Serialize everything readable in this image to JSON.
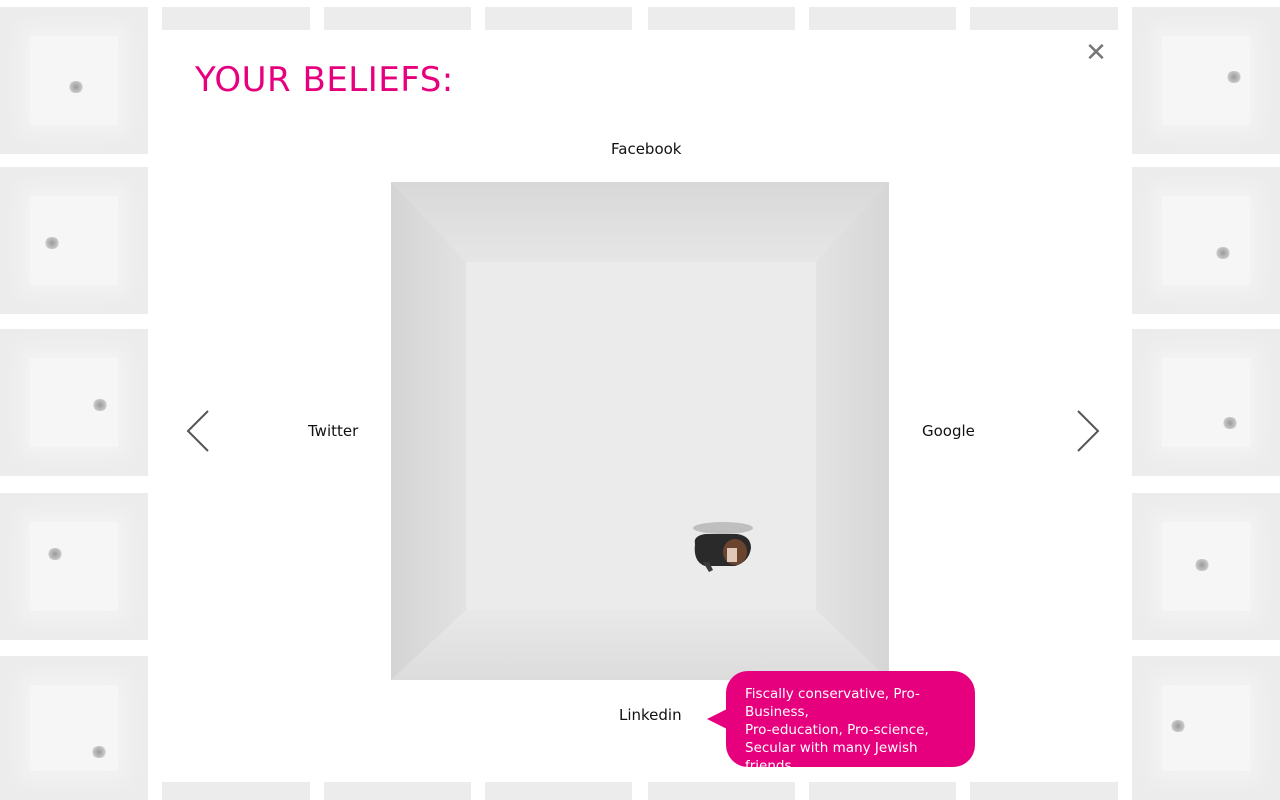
{
  "modal": {
    "title": "YOUR BELIEFS:",
    "close_icon": "close-icon",
    "labels": {
      "top": "Facebook",
      "left": "Twitter",
      "right": "Google",
      "bottom": "Linkedin"
    },
    "nav": {
      "prev_icon": "chevron-left-icon",
      "next_icon": "chevron-right-icon"
    },
    "bubble": {
      "lines": [
        "Fiscally conservative, Pro-Business,",
        "Pro-education, Pro-science,",
        "Secular with many Jewish friends"
      ]
    }
  },
  "colors": {
    "accent": "#e6007e",
    "text": "#111111",
    "close": "#777777",
    "thumb_bg": "#ececec"
  }
}
